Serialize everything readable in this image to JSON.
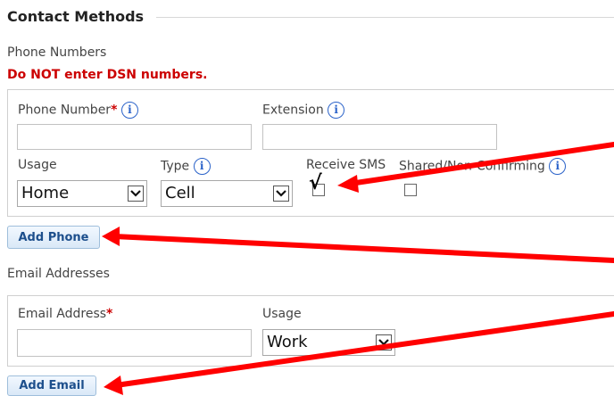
{
  "section": {
    "title": "Contact Methods"
  },
  "phone": {
    "group_label": "Phone Numbers",
    "warning": "Do NOT enter DSN numbers.",
    "number_label": "Phone Number",
    "number_value": "",
    "extension_label": "Extension",
    "extension_value": "",
    "usage_label": "Usage",
    "usage_selected": "Home",
    "type_label": "Type",
    "type_selected": "Cell",
    "sms_label": "Receive SMS",
    "sms_checked": true,
    "shared_label": "Shared/Non-Confirming",
    "shared_checked": false,
    "add_button": "Add Phone"
  },
  "email": {
    "group_label": "Email Addresses",
    "address_label": "Email Address",
    "address_value": "",
    "usage_label": "Usage",
    "usage_selected": "Work",
    "add_button": "Add Email"
  },
  "required_marker": "*",
  "info_glyph": "i",
  "check_glyph": "√",
  "colors": {
    "required": "#cc0000",
    "warning": "#cc0000",
    "info_icon": "#2a62c9",
    "button_text": "#1d4f8c",
    "annotation_arrow": "#ff0000"
  }
}
